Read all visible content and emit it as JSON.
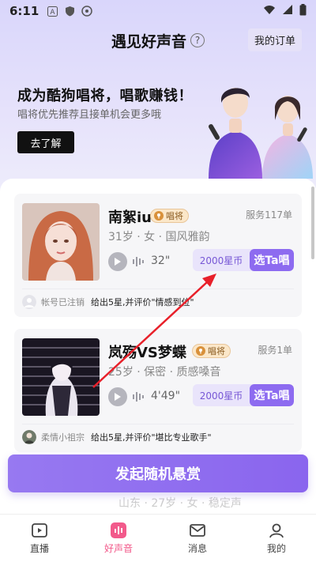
{
  "status_bar": {
    "time": "6:11",
    "left_icons": [
      "a-icon",
      "shield-icon",
      "vpn-icon"
    ],
    "right_icons": [
      "wifi-icon",
      "signal-icon",
      "battery-icon"
    ]
  },
  "header": {
    "title": "遇见好声音",
    "help": "?",
    "orders_label": "我的订单"
  },
  "banner": {
    "title": "成为酷狗唱将，唱歌赚钱！",
    "subtitle": "唱将优先推荐且接单机会更多哦",
    "cta_label": "去了解"
  },
  "singers": [
    {
      "name": "南絮iu",
      "badge": "唱将",
      "served": "服务117单",
      "meta": "31岁 · 女 · 国风雅韵",
      "duration": "32\"",
      "price": "2000星币",
      "action": "选Ta唱",
      "review_user": "帐号已注销",
      "review_text": "给出5星,并评价\"情感到位\""
    },
    {
      "name": "岚殇VS梦蝶",
      "badge": "唱将",
      "served": "服务1单",
      "meta": "25岁 · 保密 · 质感嗓音",
      "duration": "4'49\"",
      "price": "2000星币",
      "action": "选Ta唱",
      "review_user": "柔情小祖宗",
      "review_text": "给出5星,并评价\"堪比专业歌手\""
    }
  ],
  "peek_text": "山东 · 27岁 · 女 · 稳定声",
  "random_reward_label": "发起随机悬赏",
  "bottom_nav": [
    {
      "label": "直播",
      "icon": "live-icon",
      "active": false
    },
    {
      "label": "好声音",
      "icon": "voice-icon",
      "active": true
    },
    {
      "label": "消息",
      "icon": "message-icon",
      "active": false
    },
    {
      "label": "我的",
      "icon": "profile-icon",
      "active": false
    }
  ],
  "colors": {
    "accent": "#8d6bf0",
    "nav_active": "#f25a8b",
    "annotation": "#e8202a"
  }
}
